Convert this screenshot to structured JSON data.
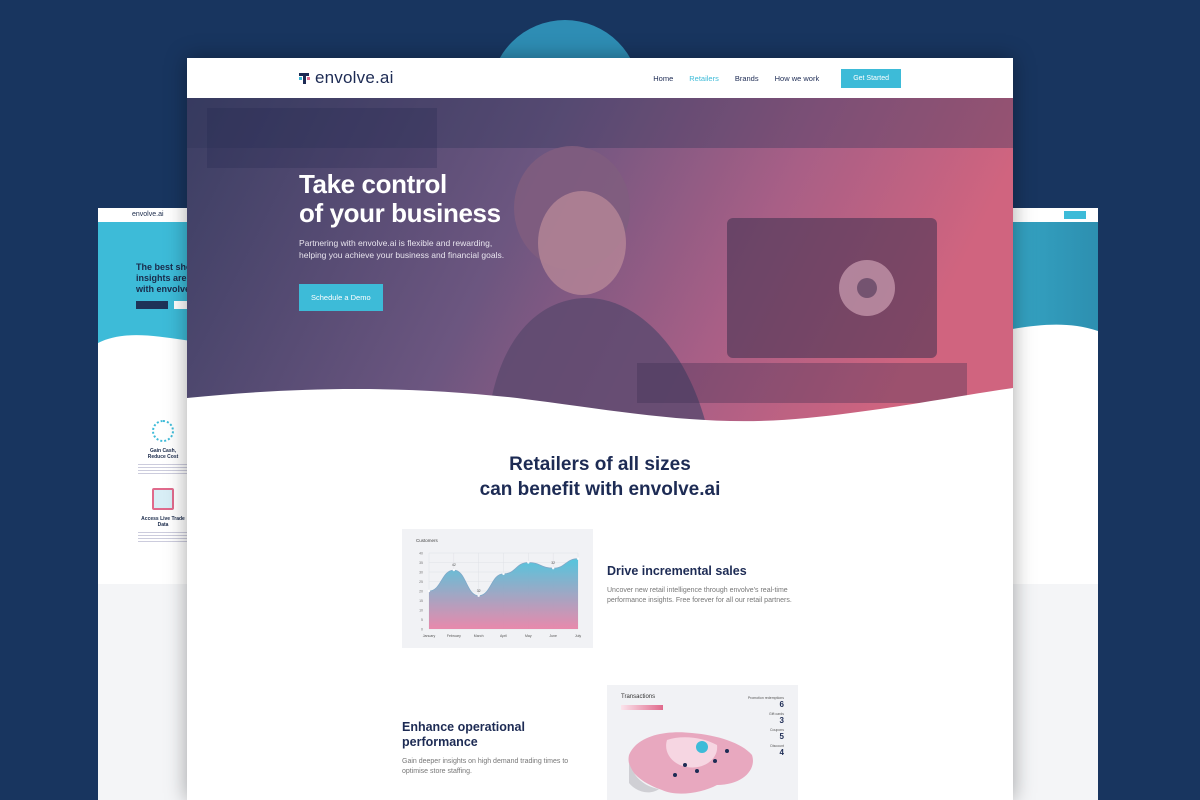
{
  "brand": {
    "name": "envolve.ai",
    "accent": "#3dbbd8",
    "navy": "#1d2b54",
    "pink": "#e06a8c",
    "background": "#18355f"
  },
  "nav": {
    "items": [
      "Home",
      "Retailers",
      "Brands",
      "How we work"
    ],
    "active": "Retailers",
    "cta": "Get Started"
  },
  "hero": {
    "title_line1": "Take control",
    "title_line2": "of your business",
    "subtitle": "Partnering with envolve.ai is flexible and rewarding, helping you achieve your business and financial goals.",
    "button": "Schedule a Demo"
  },
  "section": {
    "title_line1": "Retailers of all sizes",
    "title_line2": "can benefit with envolve.ai"
  },
  "features": [
    {
      "title": "Drive incremental sales",
      "text": "Uncover new retail intelligence through envolve's real-time performance insights. Free forever for all our retail partners."
    },
    {
      "title_line1": "Enhance operational",
      "title_line2": "performance",
      "text": "Gain deeper insights on high demand trading times to optimise store staffing."
    }
  ],
  "customers_card": {
    "label": "Customers"
  },
  "transactions_card": {
    "label": "Transactions",
    "stats": [
      {
        "label": "Promotion redemptions",
        "value": "6"
      },
      {
        "label": "Gift cards",
        "value": "3"
      },
      {
        "label": "Coupons",
        "value": "5"
      },
      {
        "label": "Discount",
        "value": "4"
      }
    ]
  },
  "side_left": {
    "logo": "envolve.ai",
    "heading_line1": "The best shop",
    "heading_line2": "insights are h",
    "heading_line3": "with envolve",
    "features": [
      {
        "title_line1": "Gain Cash,",
        "title_line2": "Reduce Cost"
      },
      {
        "title_line1": "Access Live Trade",
        "title_line2": "Data"
      }
    ]
  },
  "chart_data": {
    "type": "area",
    "title": "Customers",
    "categories": [
      "January",
      "February",
      "March",
      "April",
      "May",
      "June",
      "July"
    ],
    "values": [
      40,
      62,
      35,
      58,
      70,
      64,
      74
    ],
    "point_labels": [
      "",
      "42",
      "32",
      "",
      "",
      "32",
      ""
    ],
    "y_ticks": [
      0,
      5,
      10,
      15,
      20,
      25,
      30,
      35,
      40
    ],
    "ylim": [
      0,
      80
    ],
    "grid": true,
    "gradient_colors": [
      "#4cc3dc",
      "#e884a8"
    ]
  }
}
